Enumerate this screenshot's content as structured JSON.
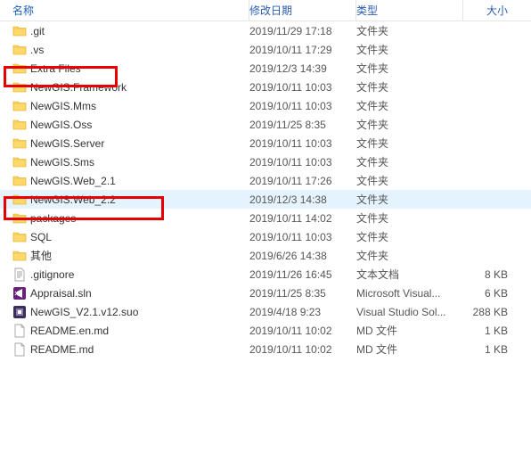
{
  "columns": {
    "name": "名称",
    "date": "修改日期",
    "type": "类型",
    "size": "大小"
  },
  "rows": [
    {
      "icon": "folder",
      "name": ".git",
      "date": "2019/11/29 17:18",
      "type": "文件夹",
      "size": ""
    },
    {
      "icon": "folder",
      "name": ".vs",
      "date": "2019/10/11 17:29",
      "type": "文件夹",
      "size": ""
    },
    {
      "icon": "folder",
      "name": "Extra Files",
      "date": "2019/12/3 14:39",
      "type": "文件夹",
      "size": ""
    },
    {
      "icon": "folder",
      "name": "NewGIS.Framework",
      "date": "2019/10/11 10:03",
      "type": "文件夹",
      "size": ""
    },
    {
      "icon": "folder",
      "name": "NewGIS.Mms",
      "date": "2019/10/11 10:03",
      "type": "文件夹",
      "size": ""
    },
    {
      "icon": "folder",
      "name": "NewGIS.Oss",
      "date": "2019/11/25 8:35",
      "type": "文件夹",
      "size": ""
    },
    {
      "icon": "folder",
      "name": "NewGIS.Server",
      "date": "2019/10/11 10:03",
      "type": "文件夹",
      "size": ""
    },
    {
      "icon": "folder",
      "name": "NewGIS.Sms",
      "date": "2019/10/11 10:03",
      "type": "文件夹",
      "size": ""
    },
    {
      "icon": "folder",
      "name": "NewGIS.Web_2.1",
      "date": "2019/10/11 17:26",
      "type": "文件夹",
      "size": ""
    },
    {
      "icon": "folder",
      "name": "NewGIS.Web_2.2",
      "date": "2019/12/3 14:38",
      "type": "文件夹",
      "size": "",
      "selected": true
    },
    {
      "icon": "folder",
      "name": "packages",
      "date": "2019/10/11 14:02",
      "type": "文件夹",
      "size": ""
    },
    {
      "icon": "folder",
      "name": "SQL",
      "date": "2019/10/11 10:03",
      "type": "文件夹",
      "size": ""
    },
    {
      "icon": "folder",
      "name": "其他",
      "date": "2019/6/26 14:38",
      "type": "文件夹",
      "size": ""
    },
    {
      "icon": "textfile",
      "name": ".gitignore",
      "date": "2019/11/26 16:45",
      "type": "文本文档",
      "size": "8 KB"
    },
    {
      "icon": "sln",
      "name": "Appraisal.sln",
      "date": "2019/11/25 8:35",
      "type": "Microsoft Visual...",
      "size": "6 KB"
    },
    {
      "icon": "suo",
      "name": "NewGIS_V2.1.v12.suo",
      "date": "2019/4/18 9:23",
      "type": "Visual Studio Sol...",
      "size": "288 KB"
    },
    {
      "icon": "file",
      "name": "README.en.md",
      "date": "2019/10/11 10:02",
      "type": "MD 文件",
      "size": "1 KB"
    },
    {
      "icon": "file",
      "name": "README.md",
      "date": "2019/10/11 10:02",
      "type": "MD 文件",
      "size": "1 KB"
    }
  ]
}
